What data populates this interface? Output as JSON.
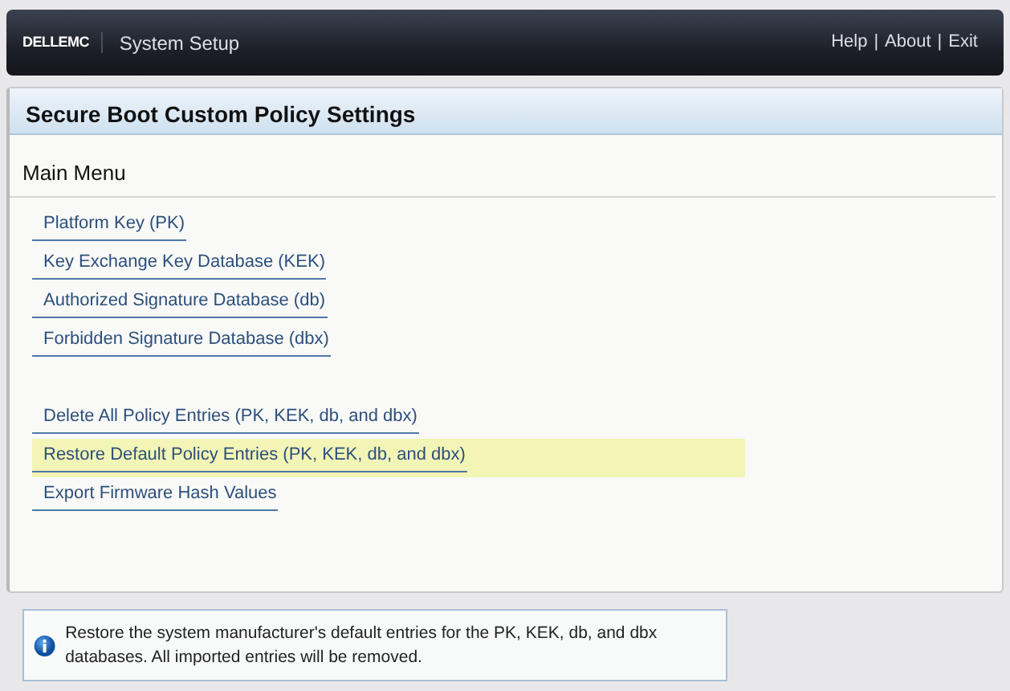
{
  "header": {
    "logo": "DELLEMC",
    "title": "System Setup",
    "links": [
      "Help",
      "About",
      "Exit"
    ],
    "separator": "|"
  },
  "panel": {
    "title": "Secure Boot Custom Policy Settings",
    "subtitle": "Main Menu",
    "sections": [
      {
        "items": [
          {
            "label": "Platform Key (PK)",
            "selected": false
          },
          {
            "label": "Key Exchange Key Database (KEK)",
            "selected": false
          },
          {
            "label": "Authorized Signature Database (db)",
            "selected": false
          },
          {
            "label": "Forbidden Signature Database (dbx)",
            "selected": false
          }
        ]
      },
      {
        "items": [
          {
            "label": "Delete All Policy Entries (PK, KEK, db, and dbx)",
            "selected": false
          },
          {
            "label": "Restore Default Policy Entries (PK, KEK, db, and dbx)",
            "selected": true
          },
          {
            "label": "Export Firmware Hash Values",
            "selected": false
          }
        ]
      }
    ]
  },
  "help": {
    "text": "Restore the system manufacturer's default entries for the PK, KEK, db, and dbx databases. All imported entries will be removed."
  }
}
